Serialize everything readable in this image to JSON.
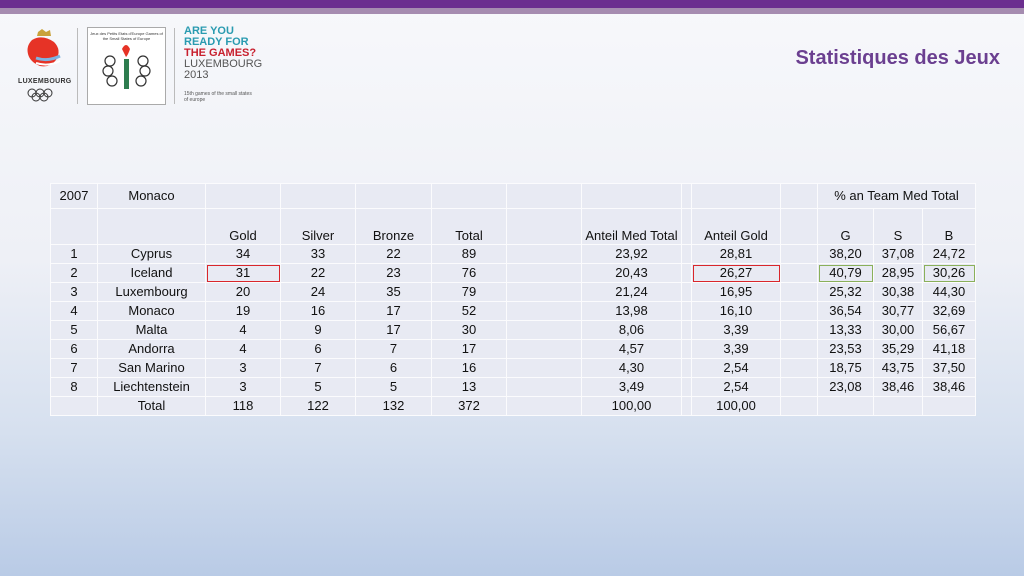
{
  "header": {
    "title": "Statistiques des Jeux",
    "logo_text": "LUXEMBOURG",
    "games_logo_text": "Jeux des Petits Etats d'Europe Games of the Small States of Europe",
    "tagline": [
      "ARE YOU",
      "READY FOR",
      "THE GAMES?",
      "LUXEMBOURG",
      "2013"
    ],
    "subtagline": "15th games of the small states of europe"
  },
  "table": {
    "year": "2007",
    "host": "Monaco",
    "headers": {
      "gold": "Gold",
      "silver": "Silver",
      "bronze": "Bronze",
      "total": "Total",
      "anteil_med": "Anteil Med Total",
      "anteil_gold": "Anteil Gold",
      "pct_group": "% an Team Med Total",
      "g": "G",
      "s": "S",
      "b": "B"
    },
    "rows": [
      {
        "rank": "1",
        "country": "Cyprus",
        "gold": "34",
        "silver": "33",
        "bronze": "22",
        "total": "89",
        "am": "23,92",
        "ag": "28,81",
        "g": "38,20",
        "s": "37,08",
        "b": "24,72"
      },
      {
        "rank": "2",
        "country": "Iceland",
        "gold": "31",
        "silver": "22",
        "bronze": "23",
        "total": "76",
        "am": "20,43",
        "ag": "26,27",
        "g": "40,79",
        "s": "28,95",
        "b": "30,26"
      },
      {
        "rank": "3",
        "country": "Luxembourg",
        "gold": "20",
        "silver": "24",
        "bronze": "35",
        "total": "79",
        "am": "21,24",
        "ag": "16,95",
        "g": "25,32",
        "s": "30,38",
        "b": "44,30"
      },
      {
        "rank": "4",
        "country": "Monaco",
        "gold": "19",
        "silver": "16",
        "bronze": "17",
        "total": "52",
        "am": "13,98",
        "ag": "16,10",
        "g": "36,54",
        "s": "30,77",
        "b": "32,69"
      },
      {
        "rank": "5",
        "country": "Malta",
        "gold": "4",
        "silver": "9",
        "bronze": "17",
        "total": "30",
        "am": "8,06",
        "ag": "3,39",
        "g": "13,33",
        "s": "30,00",
        "b": "56,67"
      },
      {
        "rank": "6",
        "country": "Andorra",
        "gold": "4",
        "silver": "6",
        "bronze": "7",
        "total": "17",
        "am": "4,57",
        "ag": "3,39",
        "g": "23,53",
        "s": "35,29",
        "b": "41,18"
      },
      {
        "rank": "7",
        "country": "San Marino",
        "gold": "3",
        "silver": "7",
        "bronze": "6",
        "total": "16",
        "am": "4,30",
        "ag": "2,54",
        "g": "18,75",
        "s": "43,75",
        "b": "37,50"
      },
      {
        "rank": "8",
        "country": "Liechtenstein",
        "gold": "3",
        "silver": "5",
        "bronze": "5",
        "total": "13",
        "am": "3,49",
        "ag": "2,54",
        "g": "23,08",
        "s": "38,46",
        "b": "38,46"
      }
    ],
    "total": {
      "label": "Total",
      "gold": "118",
      "silver": "122",
      "bronze": "132",
      "total": "372",
      "am": "100,00",
      "ag": "100,00"
    }
  }
}
